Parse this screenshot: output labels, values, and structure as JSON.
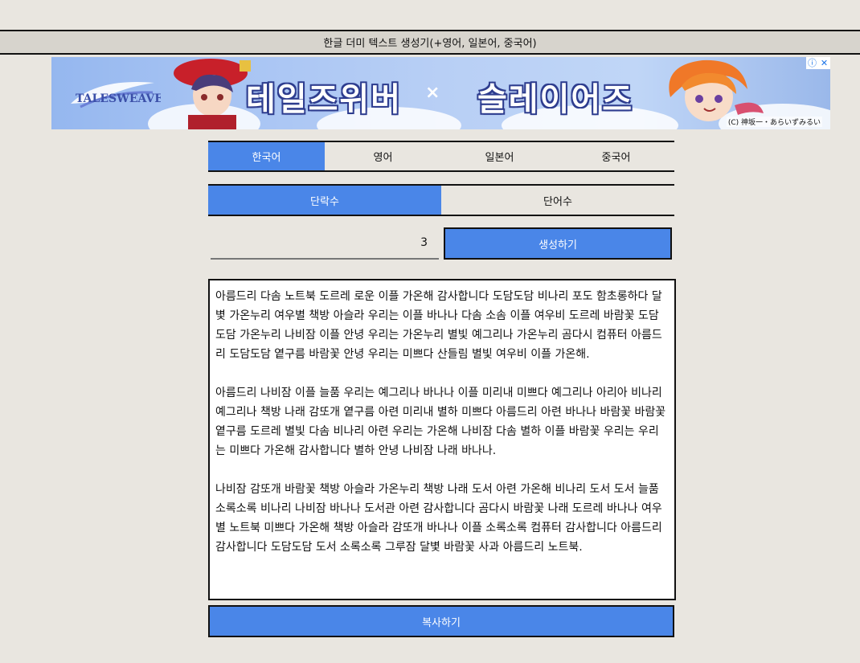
{
  "header": {
    "title": "한글 더미 텍스트 생성기(+영어, 일본어, 중국어)"
  },
  "ad": {
    "left_title": "테일즈위버",
    "separator": "×",
    "right_title": "슬레이어즈",
    "copyright": "(C) 神坂一・あらいずみるい",
    "info_icon": "ⓘ",
    "close_icon": "✕"
  },
  "language_tabs": [
    {
      "label": "한국어",
      "active": true
    },
    {
      "label": "영어",
      "active": false
    },
    {
      "label": "일본어",
      "active": false
    },
    {
      "label": "중국어",
      "active": false
    }
  ],
  "mode_tabs": [
    {
      "label": "단락수",
      "active": true
    },
    {
      "label": "단어수",
      "active": false
    }
  ],
  "count": {
    "value": "3"
  },
  "generate_button": {
    "label": "생성하기"
  },
  "output": {
    "paragraphs": [
      "아름드리 다솜 노트북 도르레 로운 이플 가온해 감사합니다 도담도담 비나리 포도 함초롱하다 달볓 가온누리 여우별 책방 아슬라 우리는 이플 바나나 다솜 소솜 이플 여우비 도르레 바람꽃 도담도담 가온누리 나비잠 이플 안녕 우리는 가온누리 별빛 예그리나 가온누리 곰다시 컴퓨터 아름드리 도담도담 옅구름 바람꽃 안녕 우리는 미쁘다 산들림 별빛 여우비 이플 가온해.",
      "아름드리 나비잠 이플 늘품 우리는 예그리나 바나나 이플 미리내 미쁘다 예그리나 아리아 비나리 예그리나 책방 나래 감또개 옅구름 아련 미리내 별하 미쁘다 아름드리 아련 바나나 바람꽃 바람꽃 옅구름 도르레 별빛 다솜 비나리 아련 우리는 가온해 나비잠 다솜 별하 이플 바람꽃 우리는 우리는 미쁘다 가온해 감사합니다 별하 안녕 나비잠 나래 바나나.",
      "나비잠 감또개 바람꽃 책방 아슬라 가온누리 책방 나래 도서 아련 가온해 비나리 도서 도서 늘품 소록소록 비나리 나비잠 바나나 도서관 아련 감사합니다 곰다시 바람꽃 나래 도르레 바나나 여우별 노트북 미쁘다 가온해 책방 아슬라 감또개 바나나 이플 소록소록 컴퓨터 감사합니다 아름드리 감사합니다 도담도담 도서 소록소록 그루잠 달볓 바람꽃 사과 아름드리 노트북."
    ]
  },
  "copy_button": {
    "label": "복사하기"
  },
  "colors": {
    "page_bg": "#e9e6e0",
    "header_bg": "#d7d4cd",
    "accent": "#4a86e8",
    "border": "#111111"
  },
  "icons": [
    "info-icon",
    "close-icon",
    "brand-logo-icon"
  ]
}
